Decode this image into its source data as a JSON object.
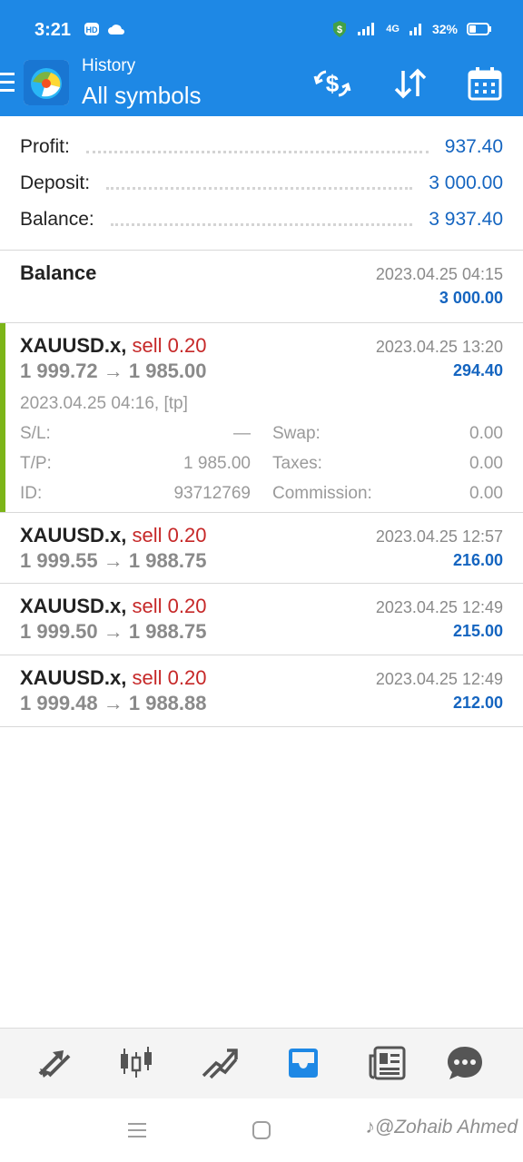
{
  "status_bar": {
    "time": "3:21",
    "network": "4G",
    "battery": "32%"
  },
  "header": {
    "subtitle": "History",
    "title": "All symbols",
    "icons": [
      "menu-icon",
      "currency-exchange-icon",
      "sort-icon",
      "calendar-icon"
    ]
  },
  "summary": {
    "profit_label": "Profit:",
    "profit_value": "937.40",
    "deposit_label": "Deposit:",
    "deposit_value": "3 000.00",
    "balance_label": "Balance:",
    "balance_value": "3 937.40"
  },
  "balance_entry": {
    "title": "Balance",
    "time": "2023.04.25 04:15",
    "amount": "3 000.00"
  },
  "deals": [
    {
      "symbol": "XAUUSD.x,",
      "type": "sell 0.20",
      "prices": "1 999.72 → 1 985.00",
      "close_time": "2023.04.25 13:20",
      "profit": "294.40",
      "open_info": "2023.04.25 04:16, [tp]",
      "sl_label": "S/L:",
      "sl_value": "—",
      "tp_label": "T/P:",
      "tp_value": "1 985.00",
      "id_label": "ID:",
      "id_value": "93712769",
      "swap_label": "Swap:",
      "swap_value": "0.00",
      "taxes_label": "Taxes:",
      "taxes_value": "0.00",
      "commission_label": "Commission:",
      "commission_value": "0.00"
    },
    {
      "symbol": "XAUUSD.x,",
      "type": "sell 0.20",
      "prices": "1 999.55 → 1 988.75",
      "close_time": "2023.04.25 12:57",
      "profit": "216.00"
    },
    {
      "symbol": "XAUUSD.x,",
      "type": "sell 0.20",
      "prices": "1 999.50 → 1 988.75",
      "close_time": "2023.04.25 12:49",
      "profit": "215.00"
    },
    {
      "symbol": "XAUUSD.x,",
      "type": "sell 0.20",
      "prices": "1 999.48 → 1 988.88",
      "close_time": "2023.04.25 12:49",
      "profit": "212.00"
    }
  ],
  "bottom_nav": {
    "items": [
      "quotes-icon",
      "chart-icon",
      "trade-icon",
      "history-icon",
      "news-icon",
      "chat-icon"
    ],
    "active": "history-icon",
    "active_color": "#1e88e5"
  },
  "watermark": "@Zohaib Ahmed",
  "colors": {
    "primary": "#1e88e5",
    "profit_blue": "#1565c0",
    "sell_red": "#c62828",
    "accent_green": "#7cb518"
  }
}
